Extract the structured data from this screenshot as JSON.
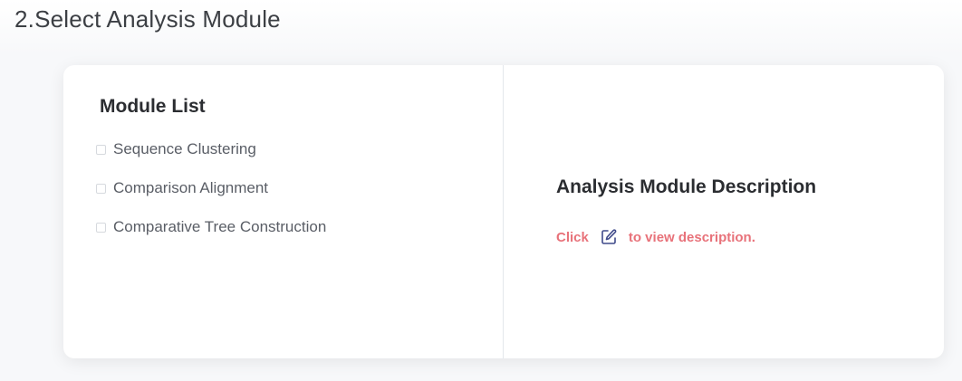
{
  "section": {
    "title": "2.Select Analysis Module"
  },
  "module_list": {
    "title": "Module List",
    "items": [
      {
        "label": "Sequence Clustering",
        "checked": false
      },
      {
        "label": "Comparison Alignment",
        "checked": false
      },
      {
        "label": "Comparative Tree Construction",
        "checked": false
      }
    ]
  },
  "description": {
    "title": "Analysis Module Description",
    "hint_prefix": "Click",
    "hint_suffix": "to view description.",
    "icon": "edit-icon"
  },
  "colors": {
    "hint_text": "#e8727a",
    "icon_stroke": "#3f4a8a",
    "title_text": "#2b2d31"
  }
}
